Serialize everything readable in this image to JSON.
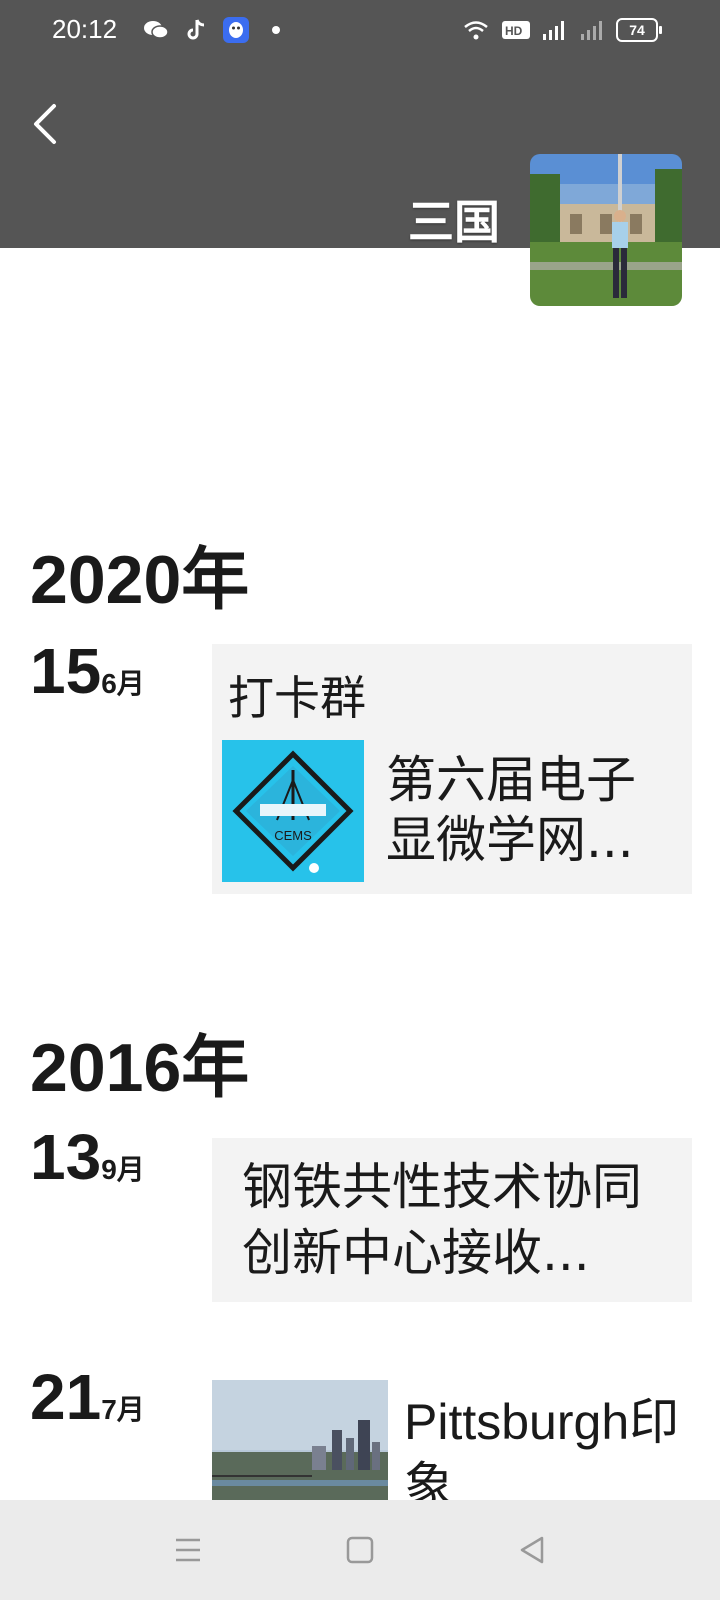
{
  "status_bar": {
    "time": "20:12",
    "left_icons": [
      "wechat-icon",
      "tiktok-icon",
      "qq-icon",
      "dot-icon"
    ],
    "right_icons": [
      "wifi-icon",
      "hd-icon",
      "4g-signal-icon",
      "signal-icon"
    ],
    "battery": "74"
  },
  "header": {
    "profile_name": "三国",
    "background_color": "#555555"
  },
  "timeline": [
    {
      "year": "2020年",
      "posts": [
        {
          "day": "15",
          "month": "6月",
          "title": "打卡群",
          "thumb_label": "CEMS",
          "text": "第六届电子显微学网..."
        }
      ]
    },
    {
      "year": "2016年",
      "posts": [
        {
          "day": "13",
          "month": "9月",
          "text": "钢铁共性技术协同创新中心接收..."
        },
        {
          "day": "21",
          "month": "7月",
          "text": "Pittsburgh印象"
        }
      ]
    }
  ]
}
